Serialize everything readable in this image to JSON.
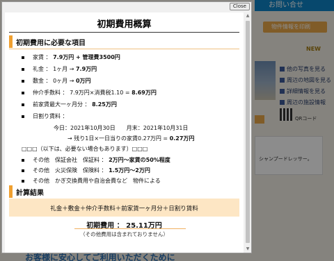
{
  "background": {
    "contact_label": "お問い合せ",
    "print_label": "物件情報を印刷",
    "new_badge": "NEW",
    "links": [
      "他の写真を見る",
      "周辺の地図を見る",
      "詳細情報を見る",
      "周辺の施設情報"
    ],
    "qr_label": "QRコード",
    "card_text": "シャンプードレッサー。",
    "bottom_text": "お客様に安心してご利用いただくために"
  },
  "modal": {
    "close_label": "Close",
    "title": "初期費用概算",
    "section1_heading": "初期費用に必要な項目",
    "items": [
      {
        "label": "家賃 ： ",
        "value": "7.9万円 + 管理費3500円"
      },
      {
        "label": "礼金 ： 1ヶ月 → ",
        "value": "7.9万円"
      },
      {
        "label": "敷金 ： 0ヶ月 → ",
        "value": "0万円"
      },
      {
        "label": "仲介手数料 ： 7.9万円×消費税1.10 = ",
        "value": "8.69万円"
      },
      {
        "label": "前家賃最大一ヶ月分 ： ",
        "value": "8.25万円"
      },
      {
        "label": "日割り賃料 ：",
        "value": ""
      }
    ],
    "prorate_line1": "今日：2021年10月30日　　月末：2021年10月31日",
    "prorate_line2_prefix": "→ 残り1日×一日当りの家賃0.27万円 = ",
    "prorate_line2_value": "0.27万円",
    "optional_note": "□□□（以下は、必要ない場合もあります）□□□",
    "others": [
      {
        "label": "その他　保証会社　保証料 ： ",
        "value": "2万円〜家賃の50%程度"
      },
      {
        "label": "その他　火災保険　保険料 ： ",
        "value": "1.5万円〜2万円"
      },
      {
        "label": "その他　かぎ交換費用や自治会費など　物件による",
        "value": ""
      }
    ],
    "section2_heading": "計算結果",
    "formula": "礼金＋敷金＋仲介手数料＋前家賃一ヶ月分＋日割り賃料",
    "total_label": "初期費用 ： ",
    "total_value": "25.11万円",
    "note": "（その他費用は含まれておりません）"
  }
}
